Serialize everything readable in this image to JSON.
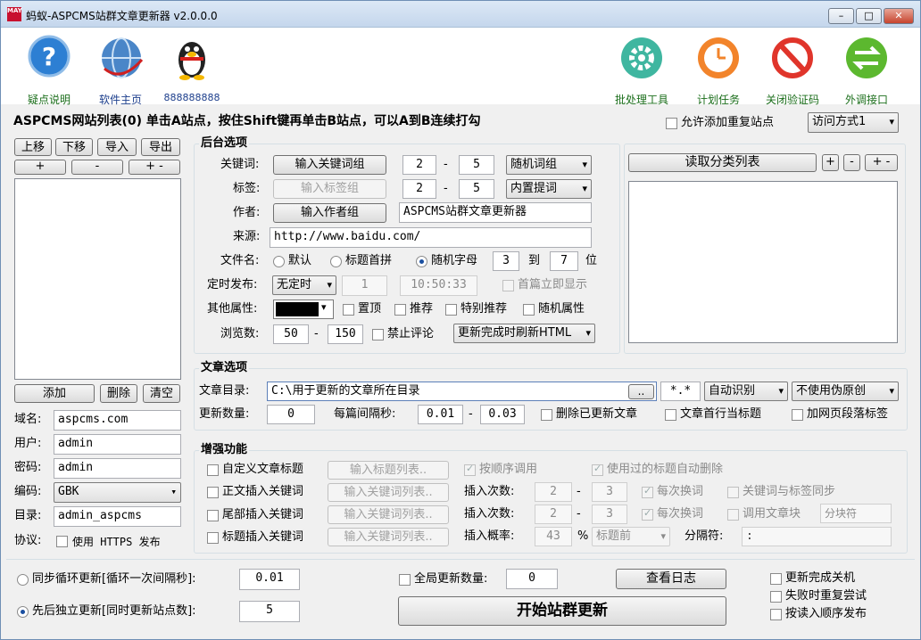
{
  "window": {
    "title": "蚂蚁-ASPCMS站群文章更新器 v2.0.0.0",
    "icon_text": "MAY"
  },
  "toolbar": {
    "left": [
      {
        "label": "疑点说明"
      },
      {
        "label": "软件主页"
      },
      {
        "label": "888888888"
      }
    ],
    "right": [
      {
        "label": "批处理工具"
      },
      {
        "label": "计划任务"
      },
      {
        "label": "关闭验证码"
      },
      {
        "label": "外调接口"
      }
    ]
  },
  "site_list": {
    "header": "ASPCMS网站列表(0)  单击A站点，按住Shift键再单击B站点，可以A到B连续打勾",
    "btn_up": "上移",
    "btn_down": "下移",
    "btn_import": "导入",
    "btn_export": "导出",
    "btn_plus": "+",
    "btn_minus": "-",
    "btn_plusminus": "+ -",
    "btn_add": "添加",
    "btn_delete": "删除",
    "btn_clear": "清空",
    "domain_label": "域名:",
    "domain": "aspcms.com",
    "user_label": "用户:",
    "user": "admin",
    "pwd_label": "密码:",
    "pwd": "admin",
    "enc_label": "编码:",
    "enc": "GBK",
    "dir_label": "目录:",
    "dir": "admin_aspcms",
    "proto_label": "协议:",
    "proto_cb": "使用 HTTPS 发布"
  },
  "top_right": {
    "allow_dup": "允许添加重复站点",
    "access": "访问方式1"
  },
  "backend": {
    "title": "后台选项",
    "kw_label": "关键词:",
    "kw_btn": "输入关键词组",
    "kw_from": "2",
    "kw_to": "5",
    "kw_mode": "随机词组",
    "tag_label": "标签:",
    "tag_btn": "输入标签组",
    "tag_from": "2",
    "tag_to": "5",
    "tag_mode": "内置提词",
    "author_label": "作者:",
    "author_btn": "输入作者组",
    "author": "ASPCMS站群文章更新器",
    "source_label": "来源:",
    "source": "http://www.baidu.com/",
    "fname_label": "文件名:",
    "r_default": "默认",
    "r_pinyin": "标题首拼",
    "r_random": "随机字母",
    "fname_from": "3",
    "to": "到",
    "fname_to": "7",
    "unit": "位",
    "sched_label": "定时发布:",
    "sched_mode": "无定时",
    "sched_num": "1",
    "sched_time": "10:50:33",
    "first_show": "首篇立即显示",
    "other_label": "其他属性:",
    "top": "置顶",
    "recommend": "推荐",
    "special": "特别推荐",
    "random_attr": "随机属性",
    "views_label": "浏览数:",
    "views_from": "50",
    "views_to": "150",
    "no_comment": "禁止评论",
    "refresh": "更新完成时刷新HTML",
    "dash": "-"
  },
  "category": {
    "btn": "读取分类列表",
    "plus": "+",
    "minus": "-",
    "plusminus": "+ -"
  },
  "article": {
    "title": "文章选项",
    "dir_label": "文章目录:",
    "dir": "C:\\用于更新的文章所在目录",
    "browse": "..",
    "ext": "*.*",
    "detect": "自动识别",
    "pseudo": "不使用伪原创",
    "count_label": "更新数量:",
    "count": "0",
    "interval_label": "每篇间隔秒:",
    "int_from": "0.01",
    "int_to": "0.03",
    "del_updated": "删除已更新文章",
    "first_line": "文章首行当标题",
    "para_tag": "加网页段落标签"
  },
  "enhance": {
    "title": "增强功能",
    "custom_title": "自定义文章标题",
    "title_list": "输入标题列表..",
    "seq": "按顺序调用",
    "auto_del": "使用过的标题自动删除",
    "body_kw": "正文插入关键词",
    "kw_list": "输入关键词列表..",
    "insert_count": "插入次数:",
    "ic_from": "2",
    "ic_to": "3",
    "each_change": "每次换词",
    "kw_tag_sync": "关键词与标签同步",
    "tail_kw": "尾部插入关键词",
    "call_block": "调用文章块",
    "block_sep": "分块符",
    "title_kw": "标题插入关键词",
    "insert_prob": "插入概率:",
    "prob": "43",
    "pct": "%",
    "pos": "标题前",
    "sep_label": "分隔符:",
    "sep": ":"
  },
  "bottom": {
    "sync_loop": "同步循环更新[循环一次间隔秒]:",
    "sync_val": "0.01",
    "independent": "先后独立更新[同时更新站点数]:",
    "ind_val": "5",
    "global_count": "全局更新数量:",
    "global_val": "0",
    "view_log": "查看日志",
    "start": "开始站群更新",
    "shutdown": "更新完成关机",
    "retry": "失败时重复尝试",
    "ordered": "按读入顺序发布"
  }
}
